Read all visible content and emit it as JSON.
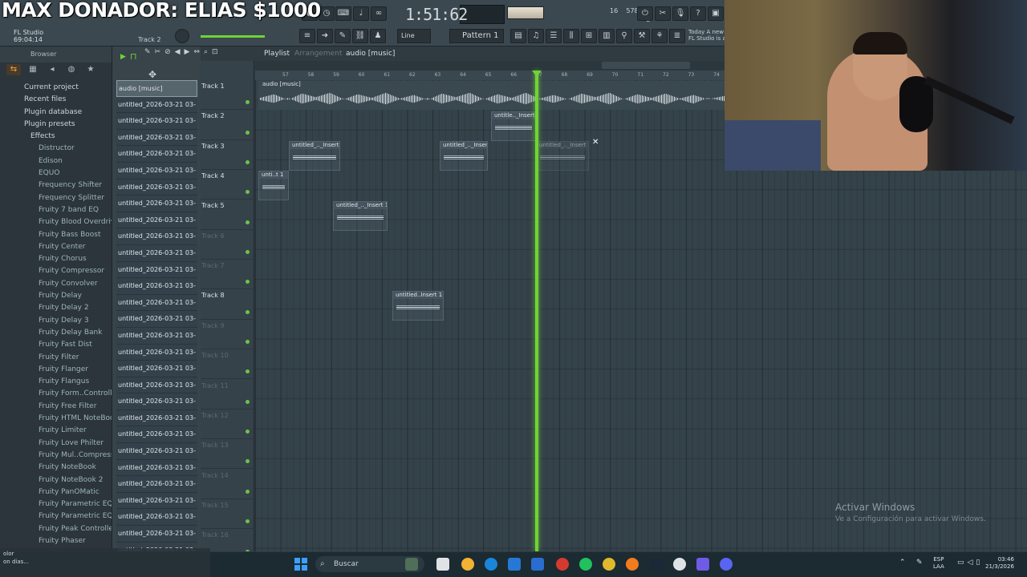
{
  "overlay": {
    "text": "MAX DONADOR: ELIAS $1000"
  },
  "toolbar": {
    "time": "1:51:62",
    "line_mode": "Line",
    "pattern": "Pattern 1",
    "app_name": "FL Studio",
    "app_time": "69:04:14",
    "track_hint": "Track 2",
    "cpu_top": "16",
    "mem": "578 MB",
    "cpu_bottom": "2",
    "news_line1": "Today  A new",
    "news_line2": "FL Studio is av"
  },
  "browser": {
    "title": "Browser",
    "items": [
      "Current project",
      "Recent files",
      "Plugin database",
      "Plugin presets"
    ],
    "effects_label": "Effects",
    "effects": [
      "Distructor",
      "Edison",
      "EQUO",
      "Frequency Shifter",
      "Frequency Splitter",
      "Fruity 7 band EQ",
      "Fruity Blood Overdrive",
      "Fruity Bass Boost",
      "Fruity Center",
      "Fruity Chorus",
      "Fruity Compressor",
      "Fruity Convolver",
      "Fruity Delay",
      "Fruity Delay 2",
      "Fruity Delay 3",
      "Fruity Delay Bank",
      "Fruity Fast Dist",
      "Fruity Filter",
      "Fruity Flanger",
      "Fruity Flangus",
      "Fruity Form..Controller",
      "Fruity Free Filter",
      "Fruity HTML NoteBook",
      "Fruity Limiter",
      "Fruity Love Philter",
      "Fruity Mul..Compressor",
      "Fruity NoteBook",
      "Fruity NoteBook 2",
      "Fruity PanOMatic",
      "Fruity Parametric EQ",
      "Fruity Parametric EQ 2",
      "Fruity Peak Controller",
      "Fruity Phaser"
    ]
  },
  "files": {
    "selected": "audio [music]",
    "items": [
      "untitled_2026-03-21 03-",
      "untitled_2026-03-21 03-",
      "untitled_2026-03-21 03-",
      "untitled_2026-03-21 03-",
      "untitled_2026-03-21 03-",
      "untitled_2026-03-21 03-",
      "untitled_2026-03-21 03-",
      "untitled_2026-03-21 03-",
      "untitled_2026-03-21 03-",
      "untitled_2026-03-21 03-",
      "untitled_2026-03-21 03-",
      "untitled_2026-03-21 03-",
      "untitled_2026-03-21 03-",
      "untitled_2026-03-21 03-",
      "untitled_2026-03-21 03-",
      "untitled_2026-03-21 03-",
      "untitled_2026-03-21 03-",
      "untitled_2026-03-21 03-",
      "untitled_2026-03-21 03-",
      "untitled_2026-03-21 03-",
      "untitled_2026-03-21 03-",
      "untitled_2026-03-21 03-",
      "untitled_2026-03-21 03-",
      "untitled_2026-03-21 03-",
      "untitled_2026-03-21 03-",
      "untitled_2026-03-21 03-",
      "untitled_2026-03-21 03-",
      "untitled_2026-03-21 03-"
    ]
  },
  "playlist": {
    "title": "Playlist",
    "subtitle": "Arrangement",
    "selected": "audio [music]",
    "ruler": [
      "57",
      "58",
      "59",
      "60",
      "61",
      "62",
      "63",
      "64",
      "65",
      "66",
      "67",
      "68",
      "69",
      "70",
      "71",
      "72",
      "73",
      "74"
    ],
    "tracks": [
      "Track 1",
      "Track 2",
      "Track 3",
      "Track 4",
      "Track 5",
      "Track 6",
      "Track 7",
      "Track 8",
      "Track 9",
      "Track 10",
      "Track 11",
      "Track 12",
      "Track 13",
      "Track 14",
      "Track 15",
      "Track 16"
    ],
    "audio_clip": "audio [music]",
    "clips": [
      {
        "label": "untitle.._Insert 1"
      },
      {
        "label": "untitled_.._Insert 1"
      },
      {
        "label": "untitled_.._Insert 1"
      },
      {
        "label": "untitled_.._Insert 1"
      },
      {
        "label": "unti..t 1"
      },
      {
        "label": "untitled_.._Insert 1"
      },
      {
        "label": "untitled..Insert 1"
      }
    ]
  },
  "watermark": {
    "line1": "Activar Windows",
    "line2": "Ve a Configuración para activar Windows."
  },
  "taskbar": {
    "search_placeholder": "Buscar",
    "lang1": "ESP",
    "lang2": "LAA",
    "time": "03:46",
    "date": "21/3/2026",
    "notif_line1": "olor",
    "notif_line2": "on dias..."
  }
}
